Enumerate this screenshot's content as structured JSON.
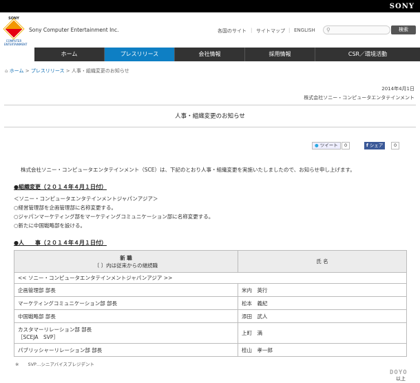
{
  "brand": {
    "sony": "SONY",
    "logo_top": "SONY",
    "logo_sub": "COMPUTER ENTERTAINMENT",
    "company": "Sony Computer Entertainment Inc."
  },
  "util_links": [
    "各国のサイト",
    "サイトマップ",
    "ENGLISH"
  ],
  "search": {
    "placeholder": "",
    "button": "検索"
  },
  "nav": [
    {
      "label": "ホーム",
      "active": false
    },
    {
      "label": "プレスリリース",
      "active": true
    },
    {
      "label": "会社情報",
      "active": false
    },
    {
      "label": "採用情報",
      "active": false
    },
    {
      "label": "CSR／環境活動",
      "active": false
    }
  ],
  "breadcrumb": {
    "home": "ホーム",
    "sep1": ">",
    "press": "プレスリリース",
    "sep2": ">",
    "current": "人事・組織変更のお知らせ"
  },
  "date": "2014年4月1日",
  "corp": "株式会社ソニー・コンピュータエンタテインメント",
  "title": "人事・組織変更のお知らせ",
  "social": {
    "tweet": "ツイート",
    "tweet_count": "0",
    "share": "シェア",
    "share_count": "0"
  },
  "intro": "株式会社ソニー・コンピュータエンタテインメント（SCE）は、下記のとおり人事・組織変更を実施いたしましたので、お知らせ申し上げます。",
  "section1": {
    "heading": "●組織変更（２０１４年４月１日付）",
    "lines": [
      "＜ソニー・コンピュータエンタテインメントジャパンアジア＞",
      "○経営管理部を企画管理部に名称変更する。",
      "○ジャパンマーケティング部をマーケティングコミュニケーション部に名称変更する。",
      "○新たに中国戦略部を設ける。"
    ]
  },
  "section2": {
    "heading": "●人　　事（２０１４年４月１日付）",
    "col1_title": "新 職",
    "col1_sub": "〔 〕内は従来からの継続職",
    "col2_title": "氏 名",
    "group": "<< ソニー・コンピュータエンタテインメントジャパンアジア >>",
    "rows": [
      {
        "pos": "企画管理部 部長",
        "pos2": "",
        "name": "米内　英行"
      },
      {
        "pos": "マーケティングコミュニケーション部 部長",
        "pos2": "",
        "name": "松本　義紀"
      },
      {
        "pos": "中国戦略部 部長",
        "pos2": "",
        "name": "添田　武人"
      },
      {
        "pos": "カスタマーリレーション部 部長",
        "pos2": "［SCEJA　SVP］",
        "name": "上町　満"
      },
      {
        "pos": "パブリッシャーリレーション部 部長",
        "pos2": "",
        "name": "桂山　孝一郎"
      }
    ]
  },
  "note": "※　　SVP…シニアバイスプレジデント",
  "closing": "以上",
  "watermark": "DOYO"
}
